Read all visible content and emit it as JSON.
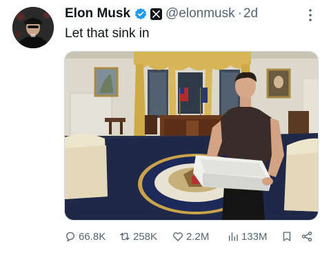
{
  "post": {
    "author_name": "Elon Musk",
    "handle": "@elonmusk",
    "separator": "·",
    "time": "2d",
    "text": "Let that sink in"
  },
  "icons": {
    "verified": "verified-badge-icon",
    "affiliate": "x-logo-icon",
    "more": "more-vertical-icon",
    "reply": "reply-icon",
    "repost": "repost-icon",
    "like": "like-icon",
    "views": "views-icon",
    "bookmark": "bookmark-icon",
    "share": "share-icon"
  },
  "colors": {
    "verified": "#1d9bf0",
    "muted": "#536471",
    "text": "#0f1419"
  },
  "metrics": {
    "replies": "66.8K",
    "reposts": "258K",
    "likes": "2.2M",
    "views": "133M"
  }
}
